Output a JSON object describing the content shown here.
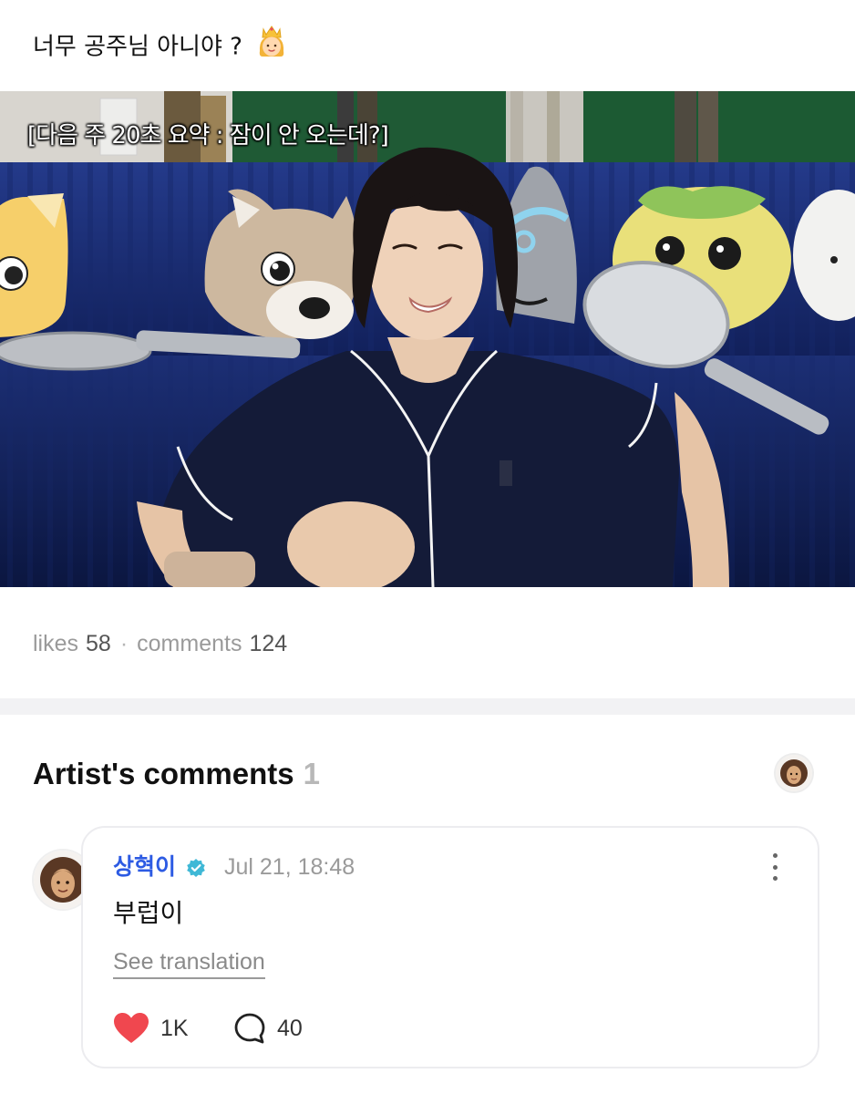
{
  "post": {
    "text": "너무 공주님 아니야 ?",
    "emoji_icon": "princess-emoji-icon"
  },
  "media": {
    "caption": "[다음 주 20초 요약 : 잠이 안 오는데?]"
  },
  "stats": {
    "likes_label": "likes",
    "likes_count": "58",
    "separator": "·",
    "comments_label": "comments",
    "comments_count": "124"
  },
  "artist_comments": {
    "title": "Artist's comments",
    "count": "1"
  },
  "comment": {
    "author": "상혁이",
    "verified_icon": "verified-badge-icon",
    "timestamp": "Jul 21, 18:48",
    "body": "부럽이",
    "translate_label": "See translation",
    "like_count": "1K",
    "reply_count": "40"
  },
  "colors": {
    "accent_blue": "#2d5be3",
    "verified": "#3fb8d6",
    "heart": "#f0474f",
    "muted": "#9a9a9a"
  }
}
